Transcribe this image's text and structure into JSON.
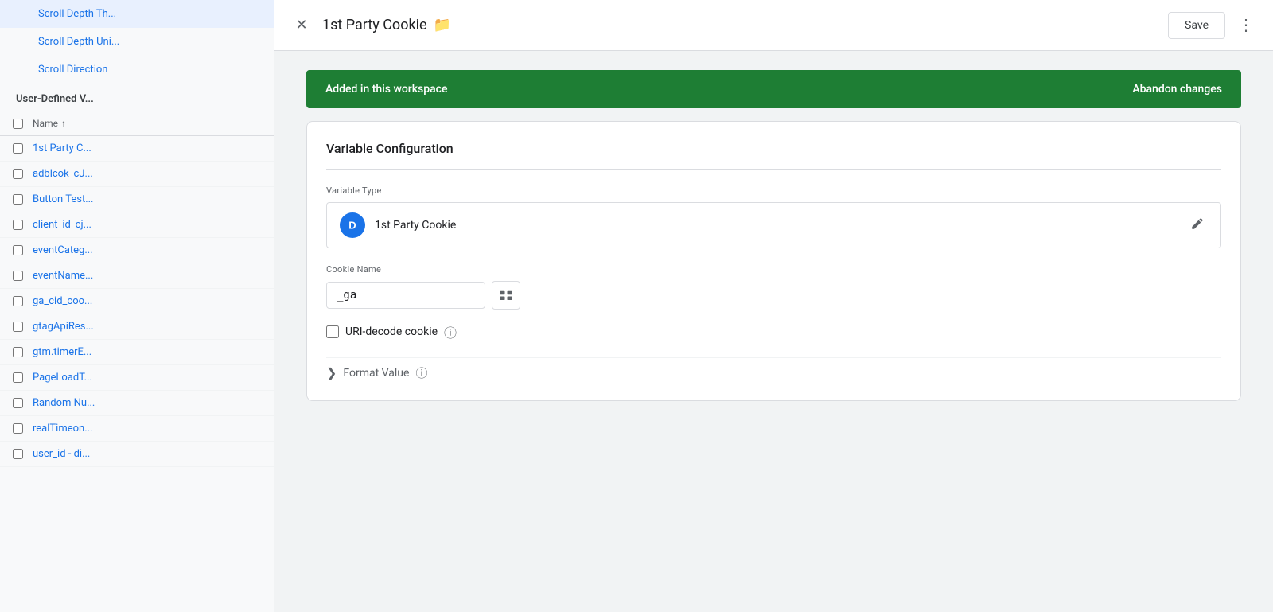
{
  "sidebar": {
    "top_items": [
      {
        "label": "Scroll Depth Th..."
      },
      {
        "label": "Scroll Depth Uni..."
      },
      {
        "label": "Scroll Direction"
      }
    ],
    "section_header": "User-Defined V...",
    "table_header": {
      "name_label": "Name",
      "sort_indicator": "↑"
    },
    "list_items": [
      {
        "label": "1st Party C..."
      },
      {
        "label": "adblcok_cJ..."
      },
      {
        "label": "Button Test..."
      },
      {
        "label": "client_id_cj..."
      },
      {
        "label": "eventCateg..."
      },
      {
        "label": "eventName..."
      },
      {
        "label": "ga_cid_coo..."
      },
      {
        "label": "gtagApiRes..."
      },
      {
        "label": "gtm.timerE..."
      },
      {
        "label": "PageLoadT..."
      },
      {
        "label": "Random Nu..."
      },
      {
        "label": "realTimeon..."
      },
      {
        "label": "user_id - di..."
      }
    ]
  },
  "modal": {
    "title": "1st Party Cookie",
    "folder_icon_label": "folder",
    "close_label": "close",
    "save_label": "Save",
    "more_label": "more options",
    "banner": {
      "text": "Added in this workspace",
      "abandon_label": "Abandon changes"
    },
    "card": {
      "title": "Variable Configuration",
      "variable_type_label": "Variable Type",
      "variable_type_name": "1st Party Cookie",
      "variable_type_icon": "D",
      "cookie_name_label": "Cookie Name",
      "cookie_name_value": "_ga",
      "cookie_name_placeholder": "_ga",
      "uri_decode_label": "URI-decode cookie",
      "uri_decode_checked": false,
      "format_value_label": "Format Value"
    }
  }
}
